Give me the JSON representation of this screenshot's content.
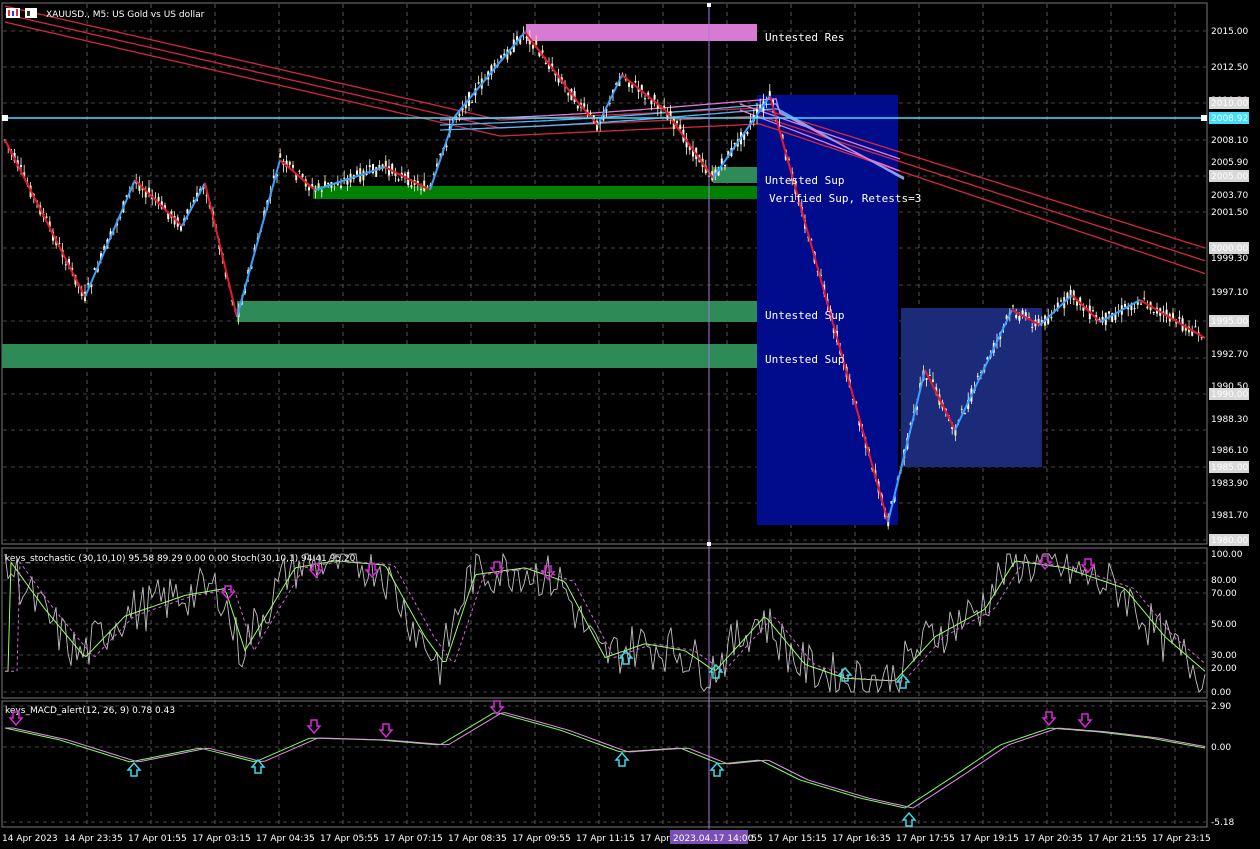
{
  "window": {
    "symbol_title": "XAUUSD., M5:  US Gold vs US dollar"
  },
  "colors": {
    "background": "#000000",
    "grid": "#8a8a8a",
    "zigzag_up": "#3aa0ff",
    "zigzag_down": "#e8192c",
    "ma_red": "#d4283e",
    "ma_blue": "#4fb8ff",
    "ma_magenta": "#e27ad6",
    "horizontal_line": "#40e0ff",
    "cursor_line": "#a57adb",
    "resistance_zone": "#d77ad3",
    "support_zone": "#2e8b57",
    "verified_zone": "#008000",
    "blue_box": "#000c8c",
    "blue_box2": "#1c2a7a",
    "candle_up": "#ffffff",
    "candle_down": "#f5f0b8",
    "stoch_main": "#c0c0c0",
    "stoch_signal": "#9cff6a",
    "stoch_dash": "#d66ad6",
    "macd_main": "#7cff5a",
    "macd_signal": "#e88cf0",
    "arrow_down": "#d32bd3",
    "arrow_up": "#40d8e8"
  },
  "icons": {
    "chart_type": "bar-chart-icon",
    "arrow_down": "magenta-down-arrow-icon",
    "arrow_up": "cyan-up-arrow-icon"
  },
  "zones": {
    "res_label": "Untested Res",
    "sup1_label": "Untested Sup",
    "verified_label": "Verified Sup, Retests=3",
    "sup2_label": "Untested Sup",
    "sup3_label": "Untested Sup"
  },
  "price_axis": {
    "labels": [
      "2015.00",
      "2012.50",
      "2010.30",
      "2010.00",
      "2008.92",
      "2008.10",
      "2005.90",
      "2005.00",
      "2003.70",
      "2001.50",
      "2000.00",
      "1999.30",
      "1997.10",
      "1995.00",
      "1992.70",
      "1990.50",
      "1990.00",
      "1988.30",
      "1986.10",
      "1985.00",
      "1983.90",
      "1981.70",
      "1980.00"
    ]
  },
  "stochastic": {
    "header": "keys_stochastic (30,10,10) 95.58 89.29 0.00 0.00 Stoch(30,10,1) 94.41 95.20",
    "levels": [
      "100.00",
      "80.00",
      "70.00",
      "50.00",
      "30.00",
      "20.00",
      "0.00"
    ]
  },
  "macd": {
    "header": "keys_MACD_alert(12, 26, 9) 0.78 0.43",
    "levels": [
      "2.90",
      "0.00",
      "-5.18"
    ]
  },
  "time_axis": {
    "labels": [
      "14 Apr 2023",
      "14 Apr 23:35",
      "17 Apr 01:55",
      "17 Apr 03:15",
      "17 Apr 04:35",
      "17 Apr 05:55",
      "17 Apr 07:15",
      "17 Apr 08:35",
      "17 Apr 09:55",
      "17 Apr 11:15",
      "17 Apr 12:35",
      "17 Apr 13:55",
      "17 Apr 15:15",
      "17 Apr 16:35",
      "17 Apr 17:55",
      "17 Apr 19:15",
      "17 Apr 20:35",
      "17 Apr 21:55",
      "17 Apr 23:15"
    ],
    "cursor_time": "2023.04.17 14:00"
  }
}
